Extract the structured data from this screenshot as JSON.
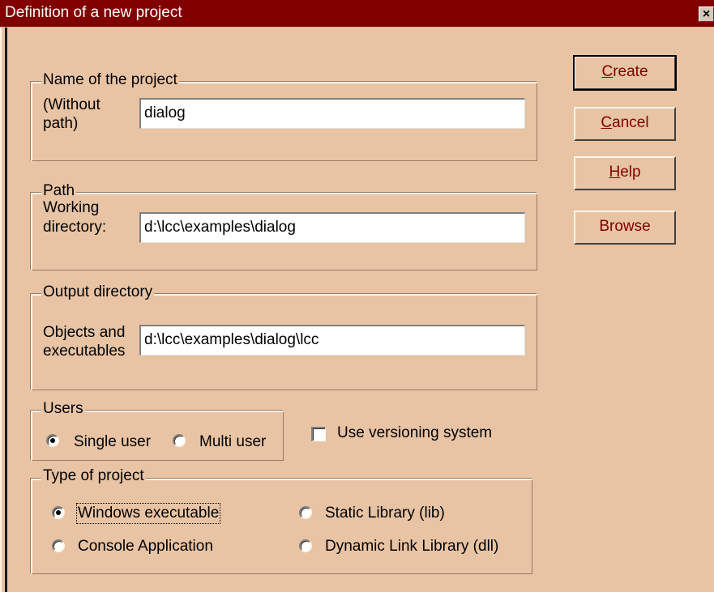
{
  "window": {
    "title": "Definition of a new project",
    "close_glyph": "×"
  },
  "buttons": {
    "create": {
      "mnemonic": "C",
      "rest": "reate"
    },
    "cancel": {
      "mnemonic": "C",
      "rest": "ancel"
    },
    "help": {
      "mnemonic": "H",
      "rest": "elp"
    },
    "browse": "Browse"
  },
  "name_group": {
    "title": "Name of the project",
    "label_line1": "(Without",
    "label_line2": "path)",
    "value": "dialog"
  },
  "path_group": {
    "title": "Path",
    "label_line1": "Working",
    "label_line2": "directory:",
    "value": "d:\\lcc\\examples\\dialog"
  },
  "output_group": {
    "title": "Output directory",
    "label_line1": "Objects and",
    "label_line2": "executables",
    "value": "d:\\lcc\\examples\\dialog\\lcc"
  },
  "users_group": {
    "title": "Users",
    "options": [
      {
        "label": "Single user",
        "checked": true
      },
      {
        "label": "Multi user",
        "checked": false
      }
    ]
  },
  "versioning": {
    "label": "Use versioning system",
    "checked": false
  },
  "project_type_group": {
    "title": "Type of project",
    "options": [
      {
        "label": "Windows executable",
        "checked": true
      },
      {
        "label": "Static Library (lib)",
        "checked": false
      },
      {
        "label": "Console Application",
        "checked": false
      },
      {
        "label": "Dynamic Link Library (dll)",
        "checked": false
      }
    ]
  },
  "colors": {
    "dialog_bg": "#e8c4a4",
    "title_bar": "#800000",
    "button_text": "#800000"
  }
}
